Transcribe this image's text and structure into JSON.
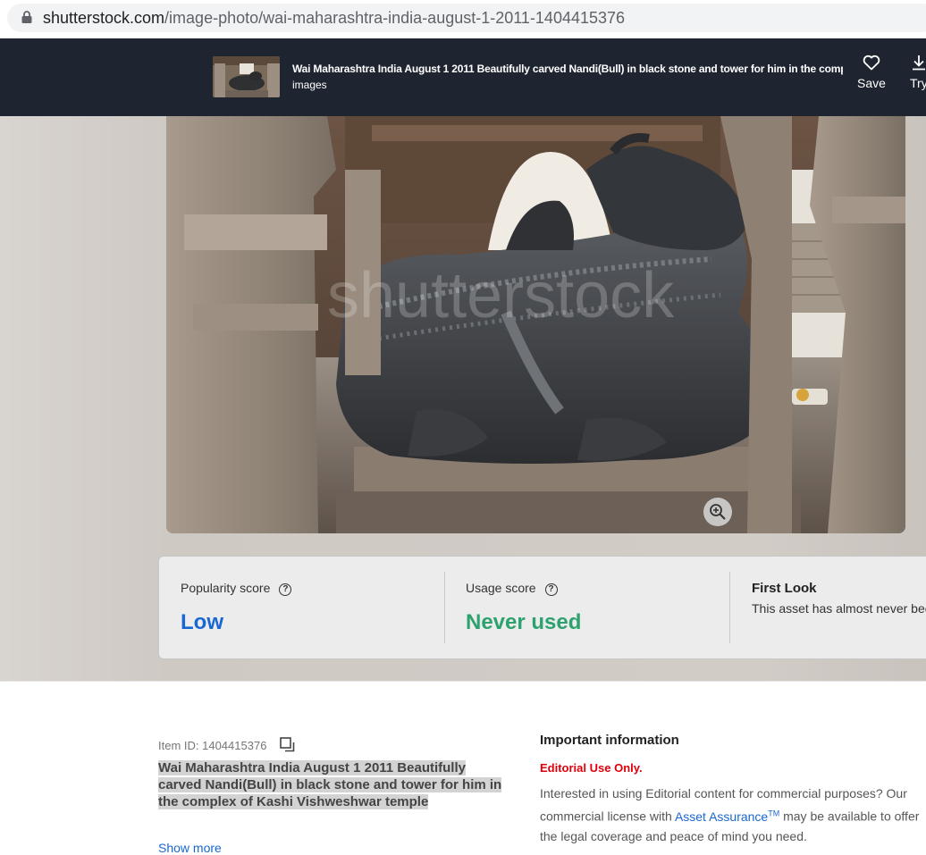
{
  "browser": {
    "url_domain": "shutterstock.com",
    "url_path": "/image-photo/wai-maharashtra-india-august-1-2011-1404415376"
  },
  "header": {
    "title": "Wai Maharashtra India August 1 2011 Beautifully carved Nandi(Bull) in black stone and tower for him in the complex of Kashi Vishweshwar temple",
    "subtitle": "images",
    "save_label": "Save",
    "try_label": "Try"
  },
  "photo": {
    "watermark": "shutterstock",
    "zoom_icon": "zoom-in-icon"
  },
  "scores": {
    "popularity_label": "Popularity score",
    "popularity_value": "Low",
    "usage_label": "Usage score",
    "usage_value": "Never used",
    "first_look_title": "First Look",
    "first_look_text": "This asset has almost never been",
    "popularity_color": "#1967d2",
    "usage_color": "#2ea26e"
  },
  "details": {
    "item_id": "Item ID: 1404415376",
    "description": "Wai Maharashtra India August 1 2011 Beautifully carved Nandi(Bull) in black stone and tower for him in the complex of Kashi Vishweshwar temple",
    "show_more": "Show more"
  },
  "info": {
    "title": "Important information",
    "editorial": "Editorial Use Only.",
    "text_before": "Interested in using Editorial content for commercial purposes? Our commercial license with ",
    "link": "Asset Assurance",
    "tm": "TM",
    "text_after": " may be available to offer the legal coverage and peace of mind you need."
  }
}
